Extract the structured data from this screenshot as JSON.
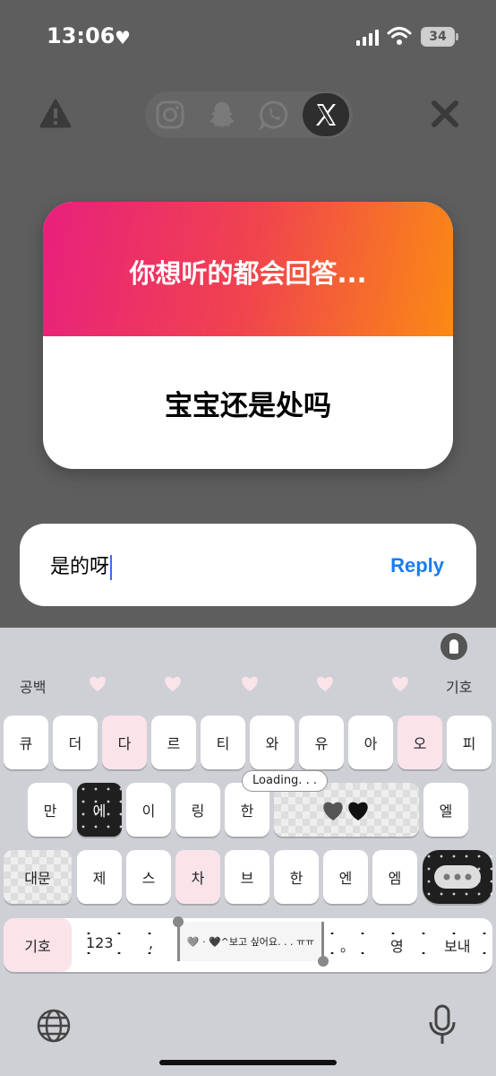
{
  "status_bar": {
    "time": "13:06",
    "battery": "34"
  },
  "toolbar": {
    "warning_icon": "warning-triangle-icon",
    "apps": [
      "instagram-icon",
      "snapchat-icon",
      "whatsapp-icon",
      "x-icon"
    ],
    "selected_app": "X",
    "close_icon": "close-icon"
  },
  "card": {
    "prompt": "你想听的都会回答...",
    "question": "宝宝还是处吗",
    "gradient": [
      "#e8207d",
      "#fa8a14"
    ]
  },
  "reply": {
    "value": "是的呀",
    "send_label": "Reply",
    "send_color": "#1a7cf0"
  },
  "keyboard": {
    "suggestions": {
      "left": "공백",
      "right": "기호"
    },
    "row1": [
      "큐",
      "더",
      "다",
      "르",
      "티",
      "와",
      "유",
      "아",
      "오",
      "피"
    ],
    "row2": [
      "만",
      "에",
      "이",
      "링",
      "한",
      "",
      "엘"
    ],
    "row3": [
      "대문",
      "제",
      "스",
      "차",
      "브",
      "한",
      "엔",
      "엠"
    ],
    "loading": "Loading. . .",
    "bottom": {
      "symbols": "기호",
      "numbers": "123",
      "comma": ",",
      "slider_text": "🩶 · 🖤^보고 싶어요. . . ㅠㅠ",
      "period": "。",
      "next": "영",
      "send": "보내"
    }
  }
}
